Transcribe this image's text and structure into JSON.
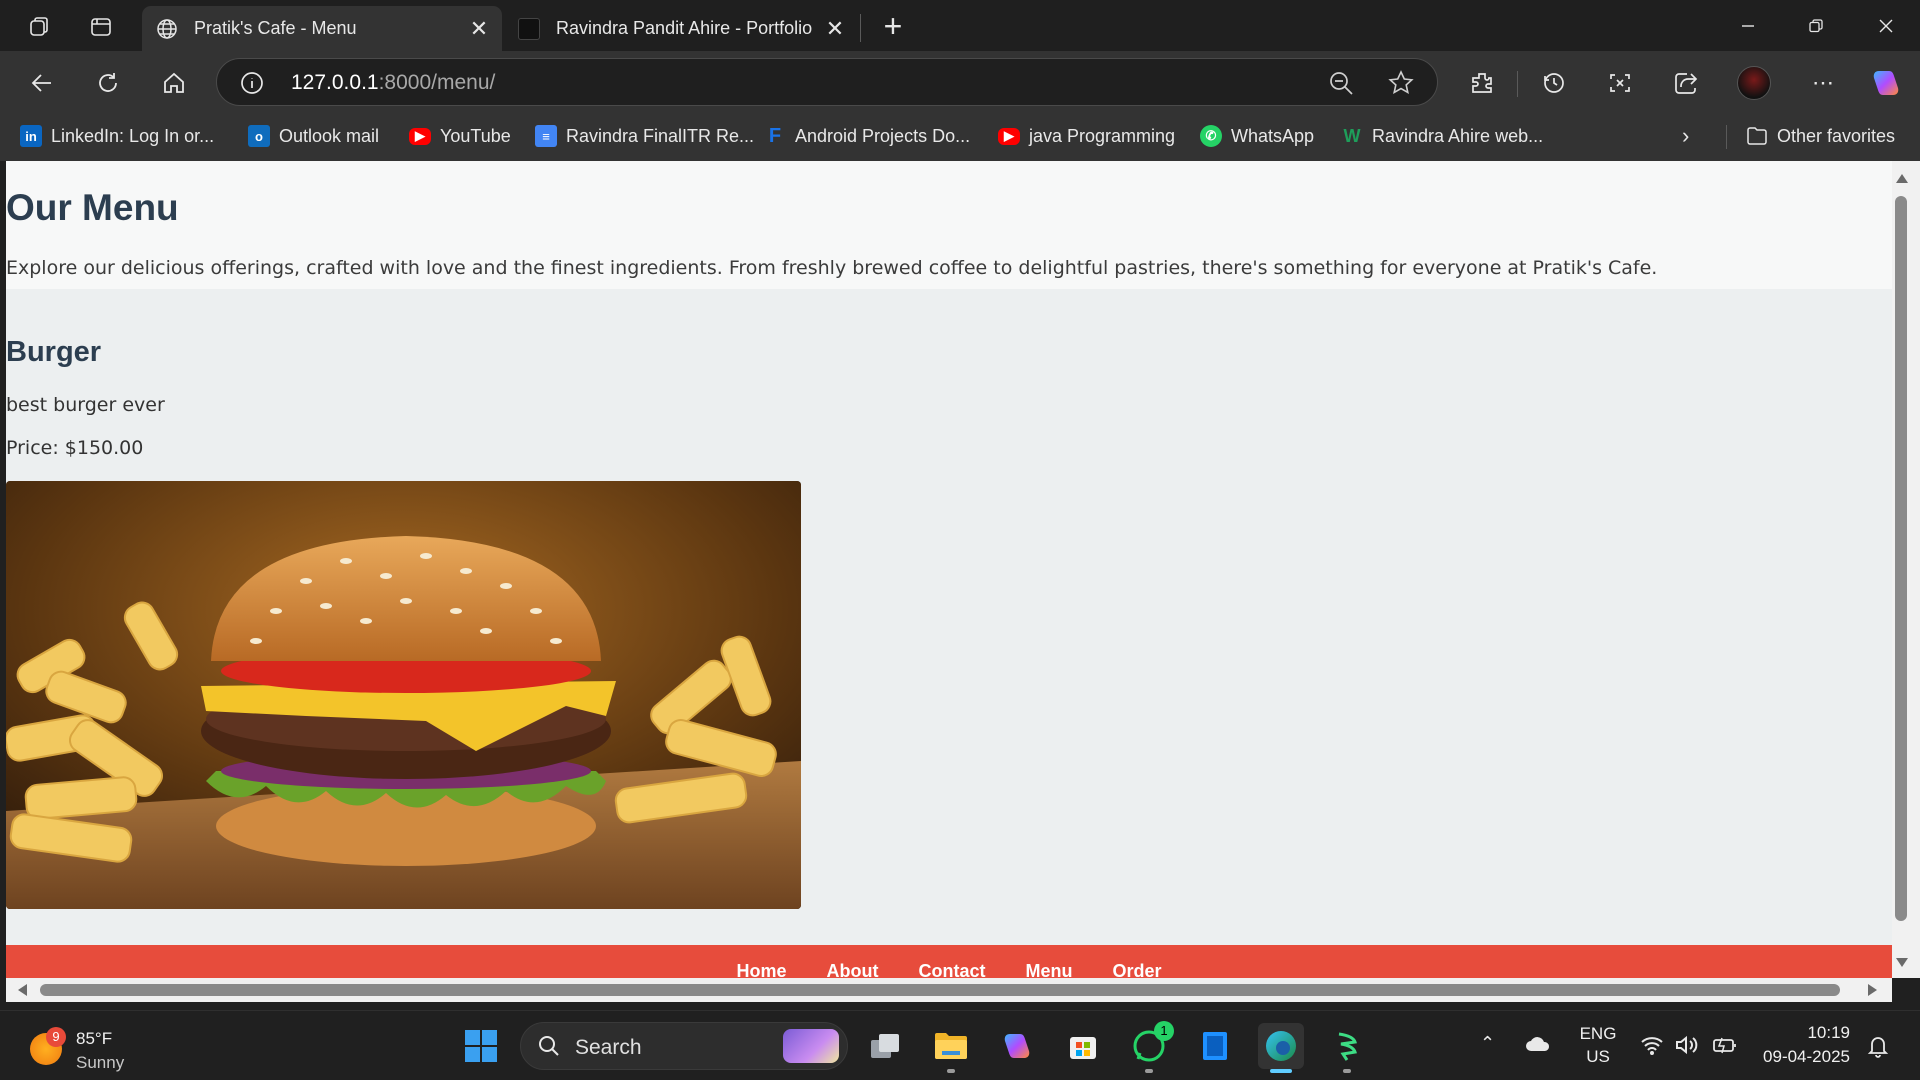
{
  "browser": {
    "tabs": [
      {
        "title": "Pratik's Cafe - Menu",
        "active": true
      },
      {
        "title": "Ravindra Pandit Ahire - Portfolio",
        "active": false
      }
    ],
    "url_host": "127.0.0.1",
    "url_rest": ":8000/menu/",
    "favorites": [
      {
        "label": "LinkedIn: Log In or...",
        "icon": "linkedin-icon",
        "color": "#0a66c2"
      },
      {
        "label": "Outlook mail",
        "icon": "outlook-icon",
        "color": "#0f6cbd"
      },
      {
        "label": "YouTube",
        "icon": "youtube-icon",
        "color": "#ff0000"
      },
      {
        "label": "Ravindra FinalITR Re...",
        "icon": "docs-icon",
        "color": "#4285f4"
      },
      {
        "label": "Android Projects Do...",
        "icon": "bookmark-icon",
        "color": "#1a73e8"
      },
      {
        "label": "java Programming",
        "icon": "youtube-icon",
        "color": "#ff0000"
      },
      {
        "label": "WhatsApp",
        "icon": "whatsapp-icon",
        "color": "#25d366"
      },
      {
        "label": "Ravindra Ahire web...",
        "icon": "web-icon",
        "color": "#1e9e5a"
      }
    ],
    "other_favorites": "Other favorites"
  },
  "page": {
    "title": "Our Menu",
    "intro": "Explore our delicious offerings, crafted with love and the finest ingredients. From freshly brewed coffee to delightful pastries, there's something for everyone at Pratik's Cafe.",
    "item": {
      "name": "Burger",
      "description": "best burger ever",
      "price": "Price: $150.00"
    },
    "footer_links": [
      "Home",
      "About",
      "Contact",
      "Menu",
      "Order"
    ],
    "footer_color": "#e74c3c",
    "heading_color": "#2c3e50"
  },
  "taskbar": {
    "weather_badge": "9",
    "temperature": "85°F",
    "condition": "Sunny",
    "search_label": "Search",
    "whatsapp_badge": "1",
    "lang_top": "ENG",
    "lang_bottom": "US",
    "time": "10:19",
    "date": "09-04-2025"
  }
}
